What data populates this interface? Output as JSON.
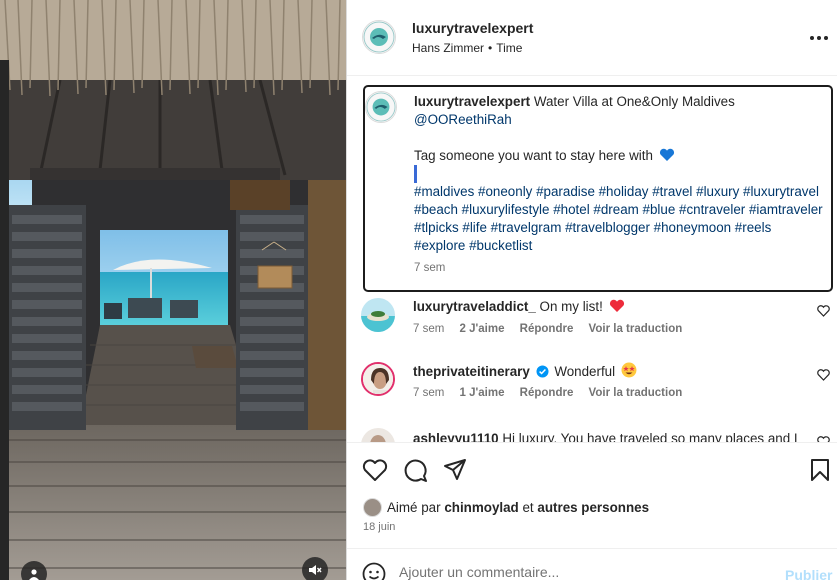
{
  "post": {
    "username": "luxurytravelexpert",
    "audio_artist": "Hans Zimmer",
    "audio_title": "Time",
    "separator": "•"
  },
  "caption": {
    "username": "luxurytravelexpert",
    "line1": "Water Villa at One&Only Maldives",
    "mention": "@OOReethiRah",
    "line2": "Tag someone you want to stay here with",
    "hashtags": "#maldives #oneonly #paradise #holiday #travel #luxury #luxurytravel #beach #luxurylifestyle #hotel #dream #blue #cntraveler #iamtraveler #tlpicks #life #travelgram #travelblogger #honeymoon #reels #explore #bucketlist",
    "time": "7 sem"
  },
  "comments": [
    {
      "username": "luxurytraveladdict_",
      "text": "On my list!",
      "time": "7 sem",
      "likes": "2 J'aime",
      "reply": "Répondre",
      "translate": "Voir la traduction"
    },
    {
      "username": "theprivateitinerary",
      "text": "Wonderful",
      "time": "7 sem",
      "likes": "1 J'aime",
      "reply": "Répondre",
      "translate": "Voir la traduction"
    },
    {
      "username": "ashleyyu1110",
      "text": "Hi luxury. You have traveled so many places and I"
    }
  ],
  "likes": {
    "prefix": "Aimé par",
    "user": "chinmoylad",
    "conj": "et",
    "others": "autres personnes"
  },
  "date": "18 juin",
  "comment_box": {
    "placeholder": "Ajouter un commentaire...",
    "post_label": "Publier"
  },
  "colors": {
    "link": "#00376b",
    "meta": "#737373",
    "heart_red": "#ed2b3b",
    "verified_blue": "#0095f6",
    "post_disabled": "#b2dffc"
  },
  "icons": [
    "user-tag-icon",
    "mute-icon",
    "more-icon",
    "heart-icon",
    "comment-icon",
    "share-icon",
    "bookmark-icon",
    "emoji-icon",
    "verified-icon",
    "blue-heart-emoji",
    "red-heart-emoji",
    "star-struck-emoji"
  ]
}
